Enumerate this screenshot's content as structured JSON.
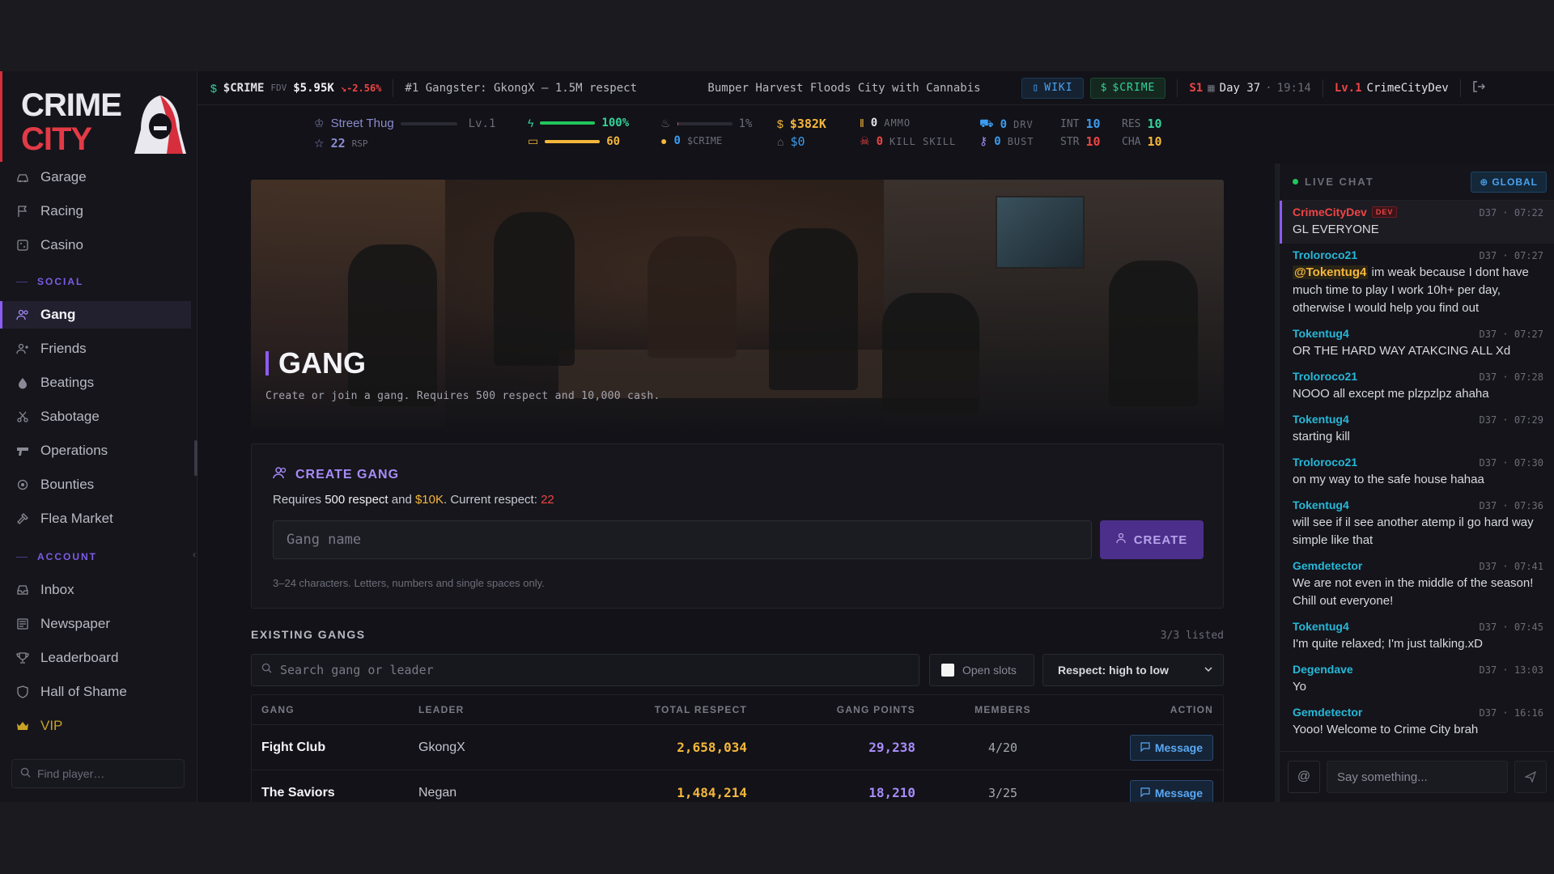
{
  "brand": {
    "line1": "CRIME",
    "line2": "CITY"
  },
  "colors": {
    "accent": "#8b5cf6",
    "brand_red": "#e23a46",
    "cash": "#f5b73b",
    "positive": "#34d399",
    "negative": "#ef4444",
    "info": "#3b9cf0"
  },
  "topbar": {
    "ticker": "$CRIME",
    "fdv_label": "FDV",
    "fdv_value": "$5.95K",
    "change": "-2.56%",
    "headline1": "#1 Gangster: GkongX — 1.5M respect",
    "headline2": "Bumper Harvest Floods City with Cannabis",
    "wiki_label": "WIKI",
    "crime_label": "$CRIME",
    "season": "S1",
    "day": "Day 37",
    "clock": "19:14",
    "level": "Lv.1",
    "username": "CrimeCityDev"
  },
  "stats": {
    "rank": "Street Thug",
    "rank_level": "Lv.1",
    "rank_progress": 0,
    "respect": "22",
    "respect_unit": "RSP",
    "energy": "100%",
    "energy_fraction": 1.0,
    "nerve": "60",
    "nerve_fraction": 1.0,
    "heat": "1%",
    "heat_fraction": 0.01,
    "crime_tokens": "0",
    "crime_tokens_unit": "$CRIME",
    "cash": "$382K",
    "bank": "$0",
    "ammo": "0",
    "ammo_label": "AMMO",
    "kill_skill": "0",
    "kill_skill_label": "KILL SKILL",
    "drv": "0",
    "drv_label": "DRV",
    "bust": "0",
    "bust_label": "BUST",
    "int_label": "INT",
    "int": "10",
    "str_label": "STR",
    "str": "10",
    "res_label": "RES",
    "res": "10",
    "cha_label": "CHA",
    "cha": "10"
  },
  "sidebar": {
    "items_top": [
      {
        "label": "Garage",
        "icon": "car-icon"
      },
      {
        "label": "Racing",
        "icon": "flag-icon"
      },
      {
        "label": "Casino",
        "icon": "dice-icon"
      }
    ],
    "social_label": "SOCIAL",
    "items_social": [
      {
        "label": "Gang",
        "icon": "users-icon",
        "active": true
      },
      {
        "label": "Friends",
        "icon": "user-plus-icon"
      },
      {
        "label": "Beatings",
        "icon": "drop-icon"
      },
      {
        "label": "Sabotage",
        "icon": "scissors-icon"
      },
      {
        "label": "Operations",
        "icon": "gun-icon"
      },
      {
        "label": "Bounties",
        "icon": "target-icon"
      },
      {
        "label": "Flea Market",
        "icon": "hammer-icon"
      }
    ],
    "account_label": "ACCOUNT",
    "items_account": [
      {
        "label": "Inbox",
        "icon": "inbox-icon"
      },
      {
        "label": "Newspaper",
        "icon": "newspaper-icon"
      },
      {
        "label": "Leaderboard",
        "icon": "trophy-icon"
      },
      {
        "label": "Hall of Shame",
        "icon": "shield-icon"
      },
      {
        "label": "VIP",
        "icon": "crown-icon"
      }
    ],
    "find_player_placeholder": "Find player…"
  },
  "hero": {
    "title": "GANG",
    "subtitle": "Create or join a gang. Requires 500 respect and 10,000 cash."
  },
  "create": {
    "heading": "CREATE GANG",
    "req_prefix": "Requires",
    "req_respect": "500 respect",
    "req_and": "and",
    "req_cash": "$10K",
    "req_current": ". Current respect:",
    "current_respect": "22",
    "input_placeholder": "Gang name",
    "button_label": "CREATE",
    "hint": "3–24 characters. Letters, numbers and single spaces only."
  },
  "existing": {
    "title": "EXISTING GANGS",
    "count": "3/3 listed",
    "search_placeholder": "Search gang or leader",
    "open_slots_label": "Open slots",
    "sort_value": "Respect: high to low",
    "columns": {
      "gang": "GANG",
      "leader": "LEADER",
      "respect": "TOTAL RESPECT",
      "points": "GANG POINTS",
      "members": "MEMBERS",
      "action": "ACTION"
    },
    "rows": [
      {
        "gang": "Fight Club",
        "leader": "GkongX",
        "respect": "2,658,034",
        "points": "29,238",
        "members": "4/20",
        "action": "Message"
      },
      {
        "gang": "The Saviors",
        "leader": "Negan",
        "respect": "1,484,214",
        "points": "18,210",
        "members": "3/25",
        "action": "Message"
      }
    ]
  },
  "chat": {
    "title": "LIVE CHAT",
    "channel": "GLOBAL",
    "dev_badge": "DEV",
    "messages": [
      {
        "user": "CrimeCityDev",
        "dev": true,
        "time": "D37 · 07:22",
        "text": "GL EVERYONE"
      },
      {
        "user": "Troloroco21",
        "time": "D37 · 07:27",
        "mention": "@Tokentug4",
        "text": " im weak because I dont have much time to play I work 10h+ per day, otherwise I would help you find out"
      },
      {
        "user": "Tokentug4",
        "time": "D37 · 07:27",
        "text": "OR THE HARD WAY ATAKCING ALL Xd"
      },
      {
        "user": "Troloroco21",
        "time": "D37 · 07:28",
        "text": "NOOO all except me plzpzlpz ahaha"
      },
      {
        "user": "Tokentug4",
        "time": "D37 · 07:29",
        "text": "starting kill"
      },
      {
        "user": "Troloroco21",
        "time": "D37 · 07:30",
        "text": "on my way to the safe house hahaa"
      },
      {
        "user": "Tokentug4",
        "time": "D37 · 07:36",
        "text": "will see if il see another atemp il go hard way simple like that"
      },
      {
        "user": "Gemdetector",
        "time": "D37 · 07:41",
        "text": "We are not even in the middle of the season! Chill out everyone!"
      },
      {
        "user": "Tokentug4",
        "time": "D37 · 07:45",
        "text": "I'm quite relaxed; I'm just talking.xD"
      },
      {
        "user": "Degendave",
        "time": "D37 · 13:03",
        "text": "Yo"
      },
      {
        "user": "Gemdetector",
        "time": "D37 · 16:16",
        "text": "Yooo! Welcome to Crime City brah"
      }
    ],
    "input_placeholder": "Say something...",
    "at_symbol": "@"
  }
}
